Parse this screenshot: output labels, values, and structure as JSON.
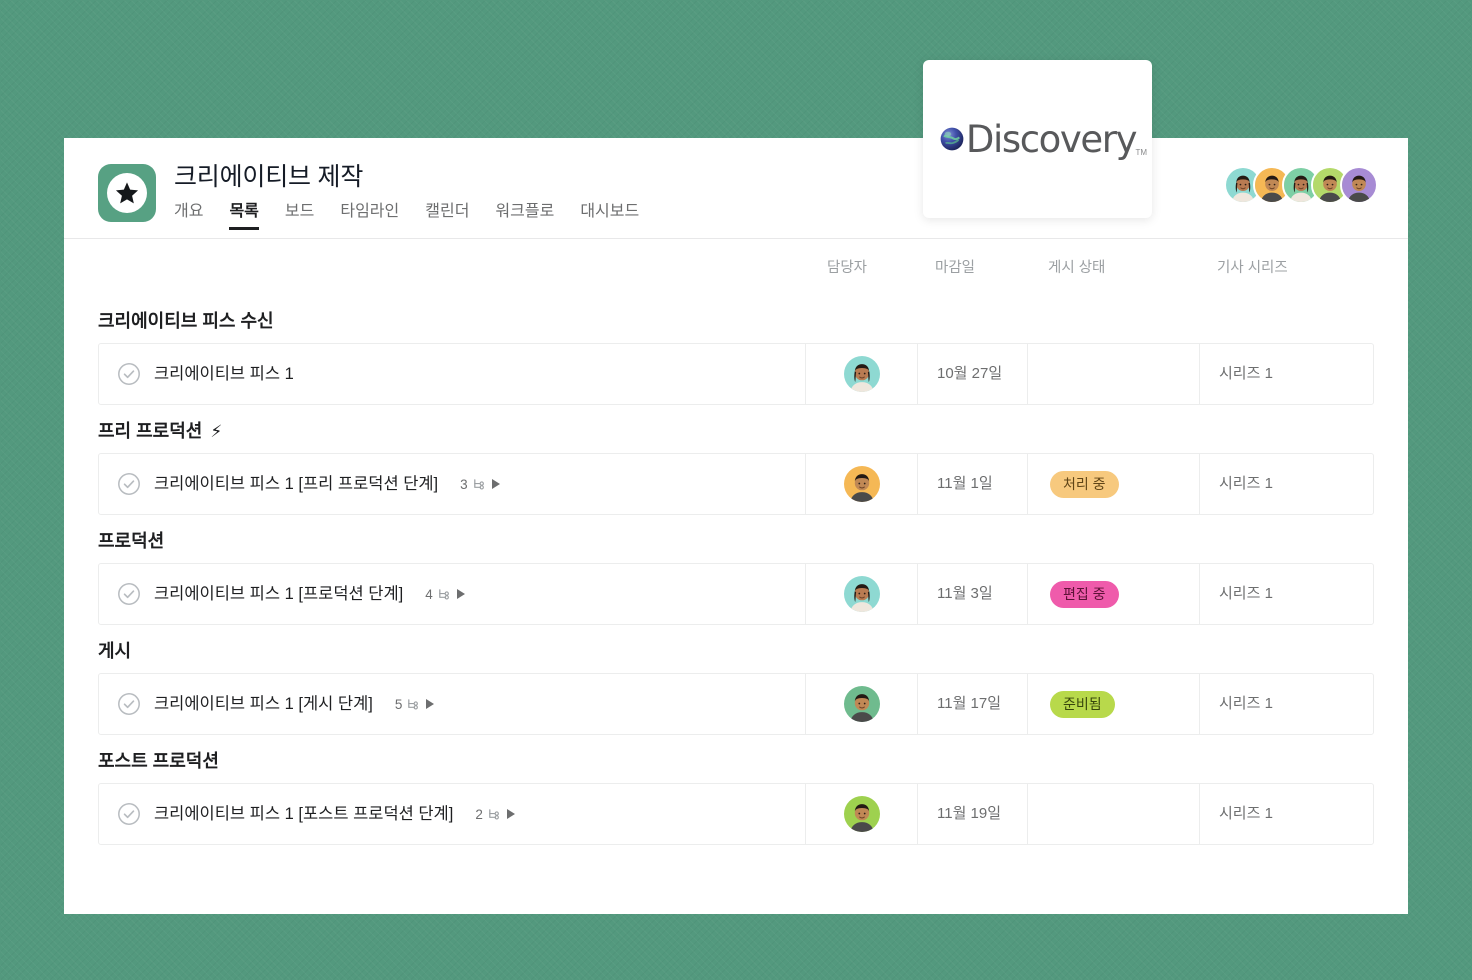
{
  "app": {
    "icon_name": "star-project-icon",
    "project_title": "크리에이티브 제작",
    "tabs": [
      {
        "label": "개요",
        "active": false
      },
      {
        "label": "목록",
        "active": true
      },
      {
        "label": "보드",
        "active": false
      },
      {
        "label": "타임라인",
        "active": false
      },
      {
        "label": "캘린더",
        "active": false
      },
      {
        "label": "워크플로",
        "active": false
      },
      {
        "label": "대시보드",
        "active": false
      }
    ],
    "members": [
      {
        "name": "member-1",
        "bg": "#8ed9d2"
      },
      {
        "name": "member-2",
        "bg": "#f5b855"
      },
      {
        "name": "member-3",
        "bg": "#7ecfa5"
      },
      {
        "name": "member-4",
        "bg": "#b4d96a"
      },
      {
        "name": "member-5",
        "bg": "#a78bd4"
      }
    ]
  },
  "columns": {
    "name": "",
    "assignee": "담당자",
    "due_date": "마감일",
    "status": "게시 상태",
    "series": "기사 시리즈"
  },
  "sections": [
    {
      "title": "크리에이티브 피스 수신",
      "bolt": "",
      "tasks": [
        {
          "name": "크리에이티브 피스 1",
          "subtask_count": "",
          "assignee_bg": "#8ed9d2",
          "assignee_type": "woman",
          "due_date": "10월 27일",
          "status": "",
          "status_bg": "",
          "status_fg": "",
          "series": "시리즈 1"
        }
      ]
    },
    {
      "title": "프리 프로덕션",
      "bolt": "⚡",
      "tasks": [
        {
          "name": "크리에이티브 피스 1 [프리 프로덕션 단계]",
          "subtask_count": "3",
          "assignee_bg": "#f5b855",
          "assignee_type": "man",
          "due_date": "11월 1일",
          "status": "처리 중",
          "status_bg": "#f7c97e",
          "status_fg": "#604517",
          "series": "시리즈 1"
        }
      ]
    },
    {
      "title": "프로덕션",
      "bolt": "",
      "tasks": [
        {
          "name": "크리에이티브 피스 1 [프로덕션 단계]",
          "subtask_count": "4",
          "assignee_bg": "#8ed9d2",
          "assignee_type": "woman",
          "due_date": "11월 3일",
          "status": "편집 중",
          "status_bg": "#ef5bab",
          "status_fg": "#5c1236",
          "series": "시리즈 1"
        }
      ]
    },
    {
      "title": "게시",
      "bolt": "",
      "tasks": [
        {
          "name": "크리에이티브 피스 1 [게시 단계]",
          "subtask_count": "5",
          "assignee_bg": "#6fbb8e",
          "assignee_type": "man",
          "due_date": "11월 17일",
          "status": "준비됨",
          "status_bg": "#b8d94b",
          "status_fg": "#38470d",
          "series": "시리즈 1"
        }
      ]
    },
    {
      "title": "포스트 프로덕션",
      "bolt": "",
      "tasks": [
        {
          "name": "크리에이티브 피스 1 [포스트 프로덕션 단계]",
          "subtask_count": "2",
          "assignee_bg": "#9ed14f",
          "assignee_type": "man",
          "due_date": "11월 19일",
          "status": "",
          "status_bg": "",
          "status_fg": "",
          "series": "시리즈 1"
        }
      ]
    }
  ],
  "logo_card": {
    "brand": "Discovery",
    "trademark": "TM",
    "globe_icon": "globe-icon"
  },
  "colors": {
    "background": "#53997e",
    "accent_green": "#57a183",
    "card": "#ffffff"
  }
}
